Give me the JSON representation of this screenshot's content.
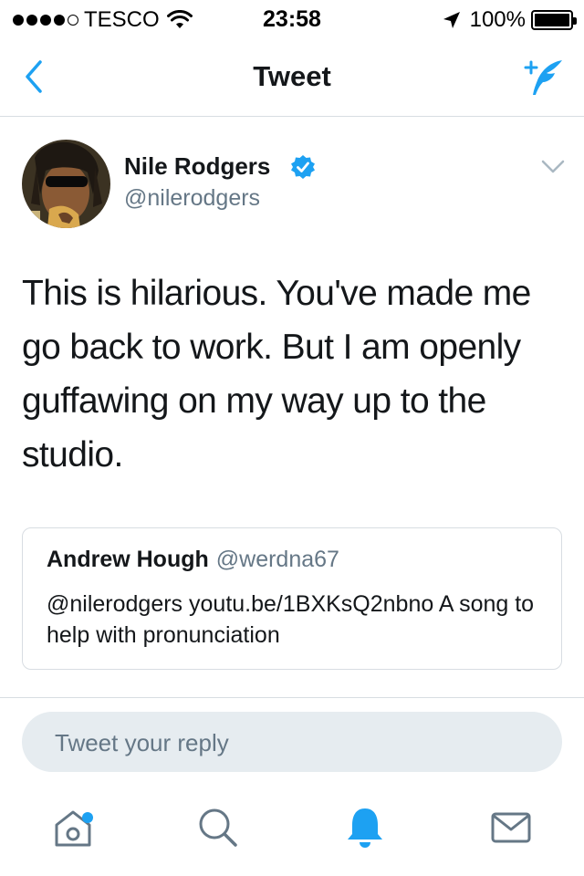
{
  "status_bar": {
    "carrier": "TESCO",
    "time": "23:58",
    "battery": "100%",
    "signal_bars_filled": 4,
    "signal_bars_total": 5
  },
  "nav": {
    "title": "Tweet",
    "back_icon": "chevron-left-icon",
    "compose_icon": "compose-tweet-icon"
  },
  "tweet": {
    "author_name": "Nile Rodgers",
    "author_handle": "@nilerodgers",
    "verified": true,
    "text": "This is hilarious. You've made me go back to work. But I am openly guffawing on my way up to the studio."
  },
  "quoted_tweet": {
    "author_name": "Andrew Hough",
    "author_handle": "@werdna67",
    "text": "@nilerodgers youtu.be/1BXKsQ2nbno A song to help with pronunciation"
  },
  "reply": {
    "placeholder": "Tweet your reply"
  },
  "tab_bar": {
    "items": [
      {
        "name": "home",
        "icon": "home-icon",
        "has_badge": true
      },
      {
        "name": "search",
        "icon": "search-icon",
        "has_badge": false
      },
      {
        "name": "notifications",
        "icon": "bell-icon",
        "active": true
      },
      {
        "name": "messages",
        "icon": "envelope-icon",
        "has_badge": false
      }
    ]
  },
  "colors": {
    "accent": "#1da1f2",
    "text": "#14171a",
    "secondary": "#657786",
    "divider": "#d8dde2",
    "reply_bg": "#e6ecf0"
  }
}
